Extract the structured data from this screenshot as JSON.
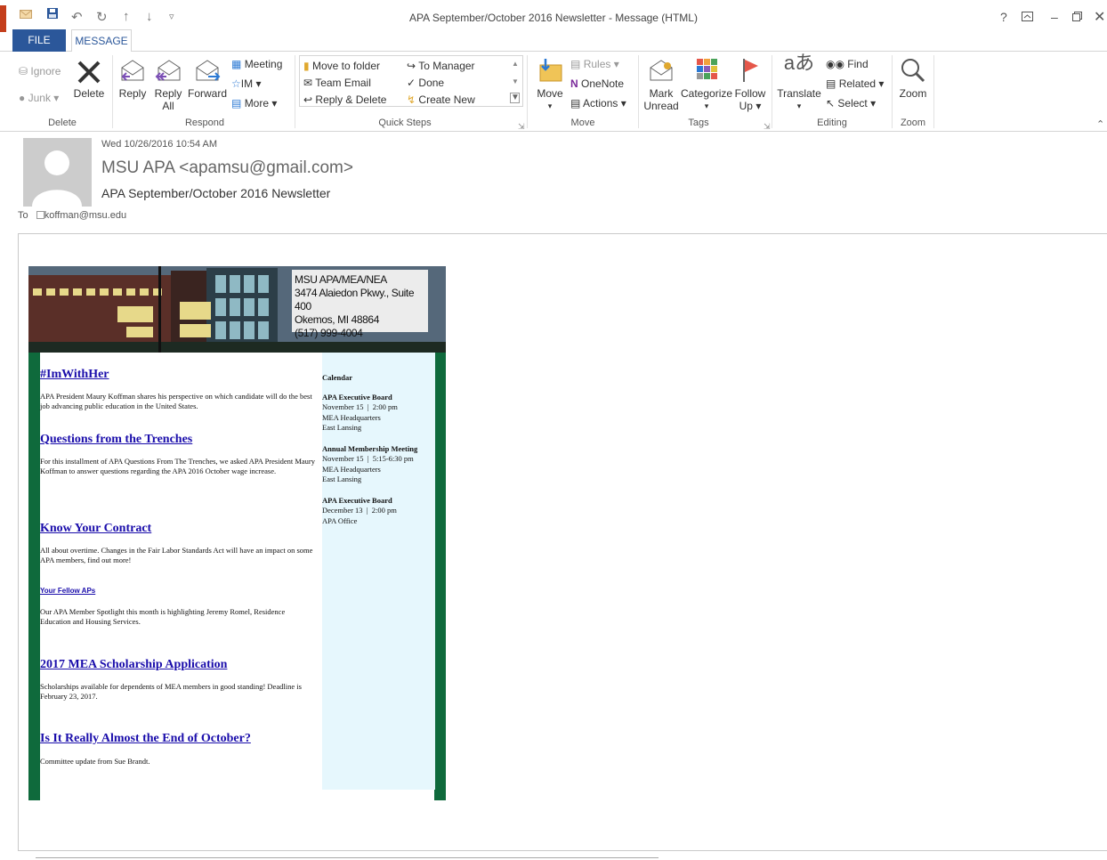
{
  "window": {
    "title": "APA September/October 2016 Newsletter - Message (HTML)"
  },
  "tabs": [
    {
      "label": "FILE"
    },
    {
      "label": "MESSAGE"
    }
  ],
  "ribbon": {
    "delete_group": {
      "ignore": "Ignore",
      "junk": "Junk",
      "delete": "Delete",
      "label": "Delete"
    },
    "respond_group": {
      "reply": "Reply",
      "reply_all_1": "Reply",
      "reply_all_2": "All",
      "forward": "Forward",
      "meeting": "Meeting",
      "im": "IM",
      "more": "More",
      "label": "Respond"
    },
    "quick_steps": {
      "move_to_folder": "Move to folder",
      "team_email": "Team Email",
      "reply_delete": "Reply & Delete",
      "to_manager": "To Manager",
      "done": "Done",
      "create_new": "Create New",
      "label": "Quick Steps"
    },
    "move_group": {
      "move": "Move",
      "rules": "Rules",
      "onenote": "OneNote",
      "actions": "Actions",
      "label": "Move"
    },
    "tags_group": {
      "mark_unread_1": "Mark",
      "mark_unread_2": "Unread",
      "categorize": "Categorize",
      "follow_up_1": "Follow",
      "follow_up_2": "Up",
      "label": "Tags"
    },
    "editing_group": {
      "translate": "Translate",
      "find": "Find",
      "related": "Related",
      "select": "Select",
      "label": "Editing"
    },
    "zoom_group": {
      "zoom": "Zoom",
      "label": "Zoom"
    }
  },
  "message": {
    "date": "Wed 10/26/2016 10:54 AM",
    "sender": "MSU APA <apamsu@gmail.com>",
    "subject": "APA September/October 2016 Newsletter",
    "to_label": "To",
    "to_value": "koffman@msu.edu"
  },
  "newsletter": {
    "address": [
      "MSU APA/MEA/NEA",
      "3474 Alaiedon Pkwy., Suite 400",
      "Okemos, MI 48864",
      "(517) 999-4004"
    ],
    "articles": [
      {
        "title": "#ImWithHer",
        "body": "APA President Maury Koffman shares his perspective on which candidate will do the best job advancing public education in the United States."
      },
      {
        "title": "Questions from the Trenches",
        "body": "For this installment of APA Questions From The Trenches, we asked APA President Maury Koffman to answer questions regarding the APA 2016 October wage increase."
      },
      {
        "title": "Know Your Contract",
        "body": "All about overtime. Changes in the Fair Labor Standards Act will have an impact on some APA members, find out more!"
      },
      {
        "title": "Your Fellow APs",
        "body": "Our APA Member Spotlight this month is highlighting Jeremy Romel, Residence Education and Housing Services."
      },
      {
        "title": "2017 MEA Scholarship Application",
        "body": "Scholarships available for dependents of MEA members in good standing! Deadline is February 23, 2017."
      },
      {
        "title": "Is It Really Almost the End of October?",
        "body": "Committee update from Sue Brandt."
      }
    ],
    "calendar": {
      "title": "Calendar",
      "events": [
        {
          "name": "APA Executive Board",
          "when": "November 15  |  2:00 pm",
          "line1": "MEA Headquarters",
          "line2": "East Lansing"
        },
        {
          "name": "Annual Membership Meeting",
          "when": "November 15  |  5:15-6:30 pm",
          "line1": "MEA Headquarters",
          "line2": "East Lansing"
        },
        {
          "name": "APA Executive Board",
          "when": "December 13  |  2:00 pm",
          "line1": "APA Office",
          "line2": ""
        }
      ]
    }
  }
}
